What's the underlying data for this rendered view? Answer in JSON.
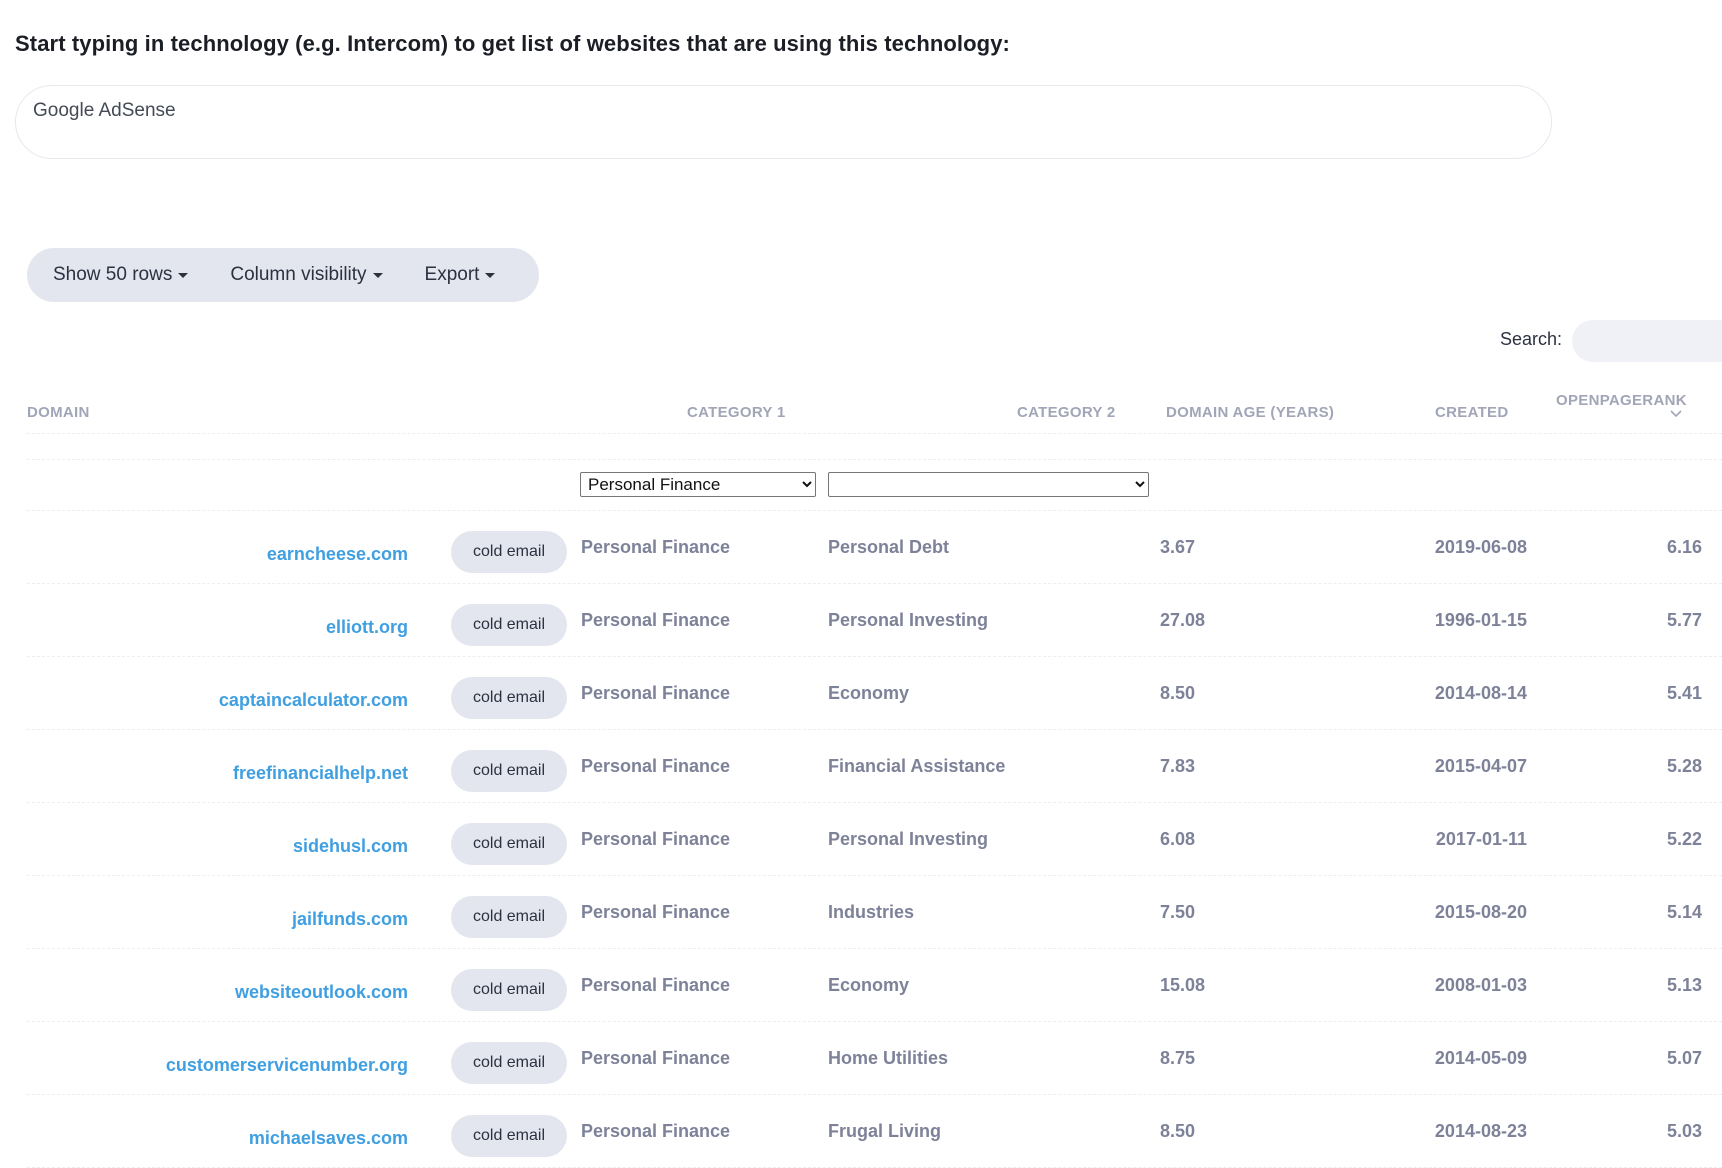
{
  "prompt": "Start typing in technology (e.g. Intercom) to get list of websites that are using this technology:",
  "tech_input": {
    "value": "Google AdSense"
  },
  "toolbar": {
    "show_rows": "Show 50 rows",
    "column_visibility": "Column visibility",
    "export": "Export"
  },
  "search": {
    "label": "Search:",
    "value": ""
  },
  "columns": {
    "domain": "DOMAIN",
    "category1": "CATEGORY 1",
    "category2": "CATEGORY 2",
    "domain_age": "DOMAIN AGE (YEARS)",
    "created": "CREATED",
    "openpagerank": "OPENPAGERANK"
  },
  "filters": {
    "category1": "Personal Finance",
    "category2": ""
  },
  "cold_email_label": "cold email",
  "rows": [
    {
      "domain": "earncheese.com",
      "cat1": "Personal Finance",
      "cat2": "Personal Debt",
      "age": "3.67",
      "created": "2019-06-08",
      "rank": "6.16"
    },
    {
      "domain": "elliott.org",
      "cat1": "Personal Finance",
      "cat2": "Personal Investing",
      "age": "27.08",
      "created": "1996-01-15",
      "rank": "5.77"
    },
    {
      "domain": "captaincalculator.com",
      "cat1": "Personal Finance",
      "cat2": "Economy",
      "age": "8.50",
      "created": "2014-08-14",
      "rank": "5.41"
    },
    {
      "domain": "freefinancialhelp.net",
      "cat1": "Personal Finance",
      "cat2": "Financial Assistance",
      "age": "7.83",
      "created": "2015-04-07",
      "rank": "5.28"
    },
    {
      "domain": "sidehusl.com",
      "cat1": "Personal Finance",
      "cat2": "Personal Investing",
      "age": "6.08",
      "created": "2017-01-11",
      "rank": "5.22"
    },
    {
      "domain": "jailfunds.com",
      "cat1": "Personal Finance",
      "cat2": "Industries",
      "age": "7.50",
      "created": "2015-08-20",
      "rank": "5.14"
    },
    {
      "domain": "websiteoutlook.com",
      "cat1": "Personal Finance",
      "cat2": "Economy",
      "age": "15.08",
      "created": "2008-01-03",
      "rank": "5.13"
    },
    {
      "domain": "customerservicenumber.org",
      "cat1": "Personal Finance",
      "cat2": "Home Utilities",
      "age": "8.75",
      "created": "2014-05-09",
      "rank": "5.07"
    },
    {
      "domain": "michaelsaves.com",
      "cat1": "Personal Finance",
      "cat2": "Frugal Living",
      "age": "8.50",
      "created": "2014-08-23",
      "rank": "5.03"
    }
  ]
}
